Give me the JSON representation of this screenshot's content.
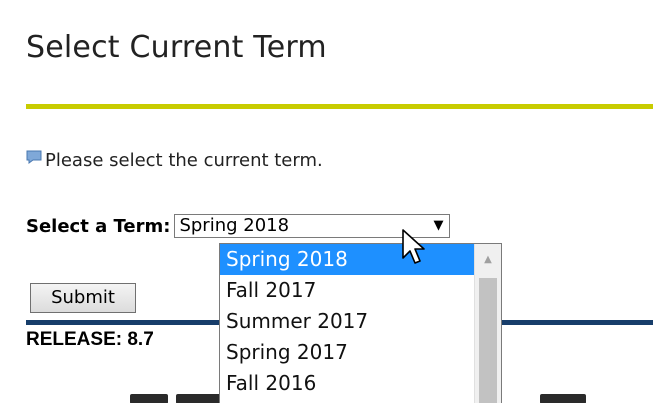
{
  "page": {
    "title": "Select Current Term",
    "info_message": "Please select the current term.",
    "release_label": "RELEASE: 8.7"
  },
  "form": {
    "term_label": "Select a Term:",
    "selected_term": "Spring 2018",
    "submit_label": "Submit",
    "term_options": [
      {
        "label": "Spring 2018",
        "selected": true
      },
      {
        "label": "Fall 2017",
        "selected": false
      },
      {
        "label": "Summer 2017",
        "selected": false
      },
      {
        "label": "Spring 2017",
        "selected": false
      },
      {
        "label": "Fall 2016",
        "selected": false
      }
    ]
  },
  "colors": {
    "accent_rule": "#c8cc00",
    "footer_rule": "#173d6a",
    "selection_highlight": "#1e90ff"
  },
  "icons": {
    "info": "speech-bubble-icon",
    "dropdown": "triangle-down-icon",
    "cursor": "mouse-pointer-icon"
  }
}
